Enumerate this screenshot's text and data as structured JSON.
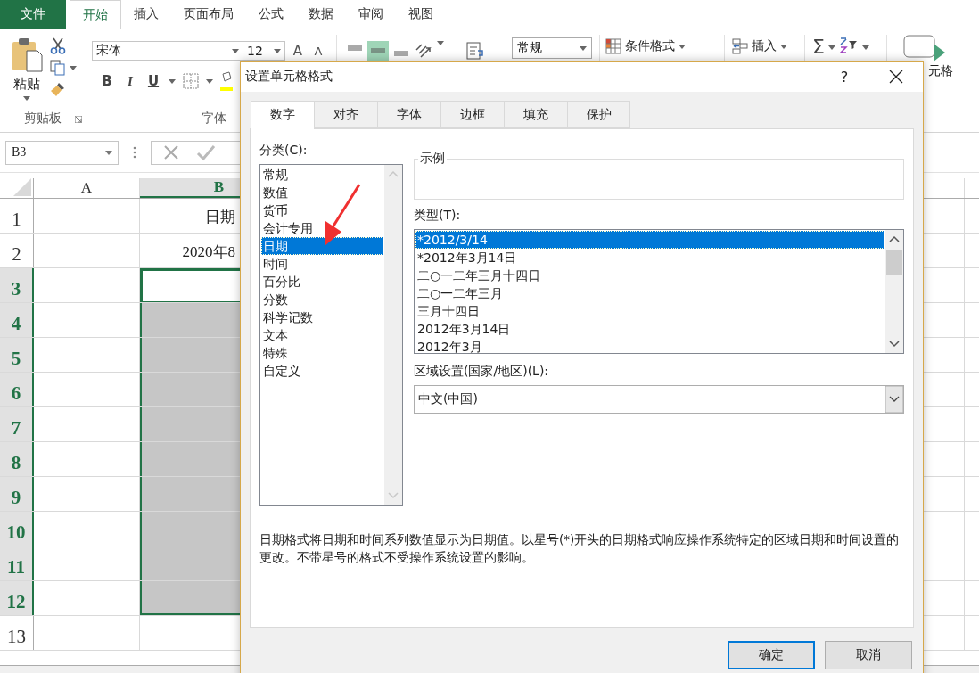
{
  "ribbon_tabs": [
    {
      "label": "文件",
      "kind": "file",
      "selected": false
    },
    {
      "label": "开始",
      "kind": "tab",
      "selected": true
    },
    {
      "label": "插入",
      "kind": "tab",
      "selected": false
    },
    {
      "label": "页面布局",
      "kind": "tab",
      "selected": false
    },
    {
      "label": "公式",
      "kind": "tab",
      "selected": false
    },
    {
      "label": "数据",
      "kind": "tab",
      "selected": false
    },
    {
      "label": "审阅",
      "kind": "tab",
      "selected": false
    },
    {
      "label": "视图",
      "kind": "tab",
      "selected": false
    }
  ],
  "clipboard": {
    "paste_label": "粘贴",
    "group_label": "剪贴板"
  },
  "font": {
    "name": "宋体",
    "size": "12",
    "size_buttons": [
      "A",
      "A"
    ],
    "style_buttons": [
      "B",
      "I",
      "U"
    ],
    "group_label": "字体"
  },
  "alignment": [
    {
      "kind": "top",
      "selected": false
    },
    {
      "kind": "middle",
      "selected": true
    },
    {
      "kind": "bottom",
      "selected": false
    }
  ],
  "number_format": "常规",
  "conditional_format": "条件格式",
  "insert": "插入",
  "sum": "Σ",
  "cells_label": "元格",
  "name_box": "B3",
  "columns": [
    {
      "label": "A",
      "selected": false
    },
    {
      "label": "B",
      "selected": true
    }
  ],
  "rows": [
    {
      "label": "1",
      "selected": false,
      "active": false,
      "cell_b": "日期"
    },
    {
      "label": "2",
      "selected": false,
      "active": false,
      "cell_b": "2020年8"
    },
    {
      "label": "3",
      "selected": true,
      "active": true
    },
    {
      "label": "4",
      "selected": true,
      "active": false
    },
    {
      "label": "5",
      "selected": true,
      "active": false
    },
    {
      "label": "6",
      "selected": true,
      "active": false
    },
    {
      "label": "7",
      "selected": true,
      "active": false
    },
    {
      "label": "8",
      "selected": true,
      "active": false
    },
    {
      "label": "9",
      "selected": true,
      "active": false
    },
    {
      "label": "10",
      "selected": true,
      "active": false
    },
    {
      "label": "11",
      "selected": true,
      "active": false
    },
    {
      "label": "12",
      "selected": true,
      "active": false
    },
    {
      "label": "13",
      "selected": false,
      "active": false
    }
  ],
  "dialog": {
    "title": "设置单元格格式",
    "help": "?",
    "tabs": [
      {
        "label": "数字",
        "selected": true
      },
      {
        "label": "对齐",
        "selected": false
      },
      {
        "label": "字体",
        "selected": false
      },
      {
        "label": "边框",
        "selected": false
      },
      {
        "label": "填充",
        "selected": false
      },
      {
        "label": "保护",
        "selected": false
      }
    ],
    "category_label": "分类(C):",
    "categories": [
      {
        "label": "常规",
        "selected": false
      },
      {
        "label": "数值",
        "selected": false
      },
      {
        "label": "货币",
        "selected": false
      },
      {
        "label": "会计专用",
        "selected": false
      },
      {
        "label": "日期",
        "selected": true
      },
      {
        "label": "时间",
        "selected": false
      },
      {
        "label": "百分比",
        "selected": false
      },
      {
        "label": "分数",
        "selected": false
      },
      {
        "label": "科学记数",
        "selected": false
      },
      {
        "label": "文本",
        "selected": false
      },
      {
        "label": "特殊",
        "selected": false
      },
      {
        "label": "自定义",
        "selected": false
      }
    ],
    "sample_label": "示例",
    "type_label": "类型(T):",
    "types": [
      {
        "label": "*2012/3/14",
        "selected": true
      },
      {
        "label": "*2012年3月14日",
        "selected": false
      },
      {
        "label": "二○一二年三月十四日",
        "selected": false
      },
      {
        "label": "二○一二年三月",
        "selected": false
      },
      {
        "label": "三月十四日",
        "selected": false
      },
      {
        "label": "2012年3月14日",
        "selected": false
      },
      {
        "label": "2012年3月",
        "selected": false
      }
    ],
    "locale_label": "区域设置(国家/地区)(L):",
    "locale": "中文(中国)",
    "description": "日期格式将日期和时间系列数值显示为日期值。以星号(*)开头的日期格式响应操作系统特定的区域日期和时间设置的更改。不带星号的格式不受操作系统设置的影响。",
    "buttons": [
      {
        "label": "确定",
        "default": true
      },
      {
        "label": "取消",
        "default": false
      }
    ]
  }
}
